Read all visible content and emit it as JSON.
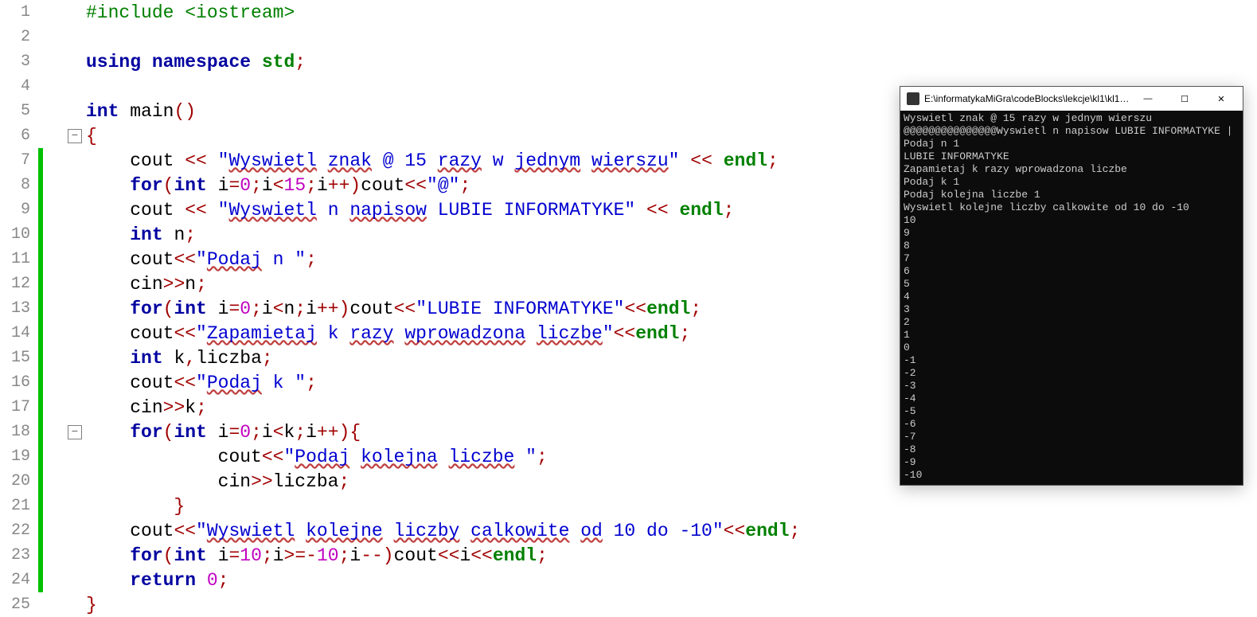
{
  "editor": {
    "lines": [
      {
        "n": "1",
        "margin": false,
        "fold": null,
        "tokens": [
          [
            "preproc",
            "#include <iostream>"
          ]
        ]
      },
      {
        "n": "2",
        "margin": false,
        "fold": null,
        "tokens": []
      },
      {
        "n": "3",
        "margin": false,
        "fold": null,
        "tokens": [
          [
            "kw",
            "using"
          ],
          [
            "ident",
            " "
          ],
          [
            "kw",
            "namespace"
          ],
          [
            "ident",
            " "
          ],
          [
            "std",
            "std"
          ],
          [
            "op",
            ";"
          ]
        ]
      },
      {
        "n": "4",
        "margin": false,
        "fold": null,
        "tokens": []
      },
      {
        "n": "5",
        "margin": false,
        "fold": null,
        "tokens": [
          [
            "kw",
            "int"
          ],
          [
            "ident",
            " "
          ],
          [
            "func",
            "main"
          ],
          [
            "op",
            "()"
          ]
        ]
      },
      {
        "n": "6",
        "margin": false,
        "fold": "box",
        "tokens": [
          [
            "op",
            "{"
          ]
        ]
      },
      {
        "n": "7",
        "margin": true,
        "fold": "line",
        "tokens": [
          [
            "ident",
            "    "
          ],
          [
            "ident",
            "cout"
          ],
          [
            "ident",
            " "
          ],
          [
            "op",
            "<<"
          ],
          [
            "ident",
            " "
          ],
          [
            "str",
            "\""
          ],
          [
            "str-u",
            "Wyswietl"
          ],
          [
            "str",
            " "
          ],
          [
            "str-u",
            "znak"
          ],
          [
            "str",
            " @ 15 "
          ],
          [
            "str-u",
            "razy"
          ],
          [
            "str",
            " w "
          ],
          [
            "str-u",
            "jednym"
          ],
          [
            "str",
            " "
          ],
          [
            "str-u",
            "wierszu"
          ],
          [
            "str",
            "\""
          ],
          [
            "ident",
            " "
          ],
          [
            "op",
            "<<"
          ],
          [
            "ident",
            " "
          ],
          [
            "endl",
            "endl"
          ],
          [
            "op",
            ";"
          ]
        ]
      },
      {
        "n": "8",
        "margin": true,
        "fold": "line",
        "tokens": [
          [
            "ident",
            "    "
          ],
          [
            "kw",
            "for"
          ],
          [
            "op",
            "("
          ],
          [
            "kw",
            "int"
          ],
          [
            "ident",
            " i"
          ],
          [
            "op",
            "="
          ],
          [
            "num",
            "0"
          ],
          [
            "op",
            ";"
          ],
          [
            "ident",
            "i"
          ],
          [
            "op",
            "<"
          ],
          [
            "num",
            "15"
          ],
          [
            "op",
            ";"
          ],
          [
            "ident",
            "i"
          ],
          [
            "op",
            "++)"
          ],
          [
            "ident",
            "cout"
          ],
          [
            "op",
            "<<"
          ],
          [
            "str",
            "\"@\""
          ],
          [
            "op",
            ";"
          ]
        ]
      },
      {
        "n": "9",
        "margin": true,
        "fold": "line",
        "tokens": [
          [
            "ident",
            "    "
          ],
          [
            "ident",
            "cout"
          ],
          [
            "ident",
            " "
          ],
          [
            "op",
            "<<"
          ],
          [
            "ident",
            " "
          ],
          [
            "str",
            "\""
          ],
          [
            "str-u",
            "Wyswietl"
          ],
          [
            "str",
            " n "
          ],
          [
            "str-u",
            "napisow"
          ],
          [
            "str",
            " LUBIE INFORMATYKE\""
          ],
          [
            "ident",
            " "
          ],
          [
            "op",
            "<<"
          ],
          [
            "ident",
            " "
          ],
          [
            "endl",
            "endl"
          ],
          [
            "op",
            ";"
          ]
        ]
      },
      {
        "n": "10",
        "margin": true,
        "fold": "line",
        "tokens": [
          [
            "ident",
            "    "
          ],
          [
            "kw",
            "int"
          ],
          [
            "ident",
            " n"
          ],
          [
            "op",
            ";"
          ]
        ]
      },
      {
        "n": "11",
        "margin": true,
        "fold": "line",
        "tokens": [
          [
            "ident",
            "    "
          ],
          [
            "ident",
            "cout"
          ],
          [
            "op",
            "<<"
          ],
          [
            "str",
            "\""
          ],
          [
            "str-u",
            "Podaj"
          ],
          [
            "str",
            " n \""
          ],
          [
            "op",
            ";"
          ]
        ]
      },
      {
        "n": "12",
        "margin": true,
        "fold": "line",
        "tokens": [
          [
            "ident",
            "    "
          ],
          [
            "ident",
            "cin"
          ],
          [
            "op",
            ">>"
          ],
          [
            "ident",
            "n"
          ],
          [
            "op",
            ";"
          ]
        ]
      },
      {
        "n": "13",
        "margin": true,
        "fold": "line",
        "tokens": [
          [
            "ident",
            "    "
          ],
          [
            "kw",
            "for"
          ],
          [
            "op",
            "("
          ],
          [
            "kw",
            "int"
          ],
          [
            "ident",
            " i"
          ],
          [
            "op",
            "="
          ],
          [
            "num",
            "0"
          ],
          [
            "op",
            ";"
          ],
          [
            "ident",
            "i"
          ],
          [
            "op",
            "<"
          ],
          [
            "ident",
            "n"
          ],
          [
            "op",
            ";"
          ],
          [
            "ident",
            "i"
          ],
          [
            "op",
            "++)"
          ],
          [
            "ident",
            "cout"
          ],
          [
            "op",
            "<<"
          ],
          [
            "str",
            "\"LUBIE INFORMATYKE\""
          ],
          [
            "op",
            "<<"
          ],
          [
            "endl",
            "endl"
          ],
          [
            "op",
            ";"
          ]
        ]
      },
      {
        "n": "14",
        "margin": true,
        "fold": "line",
        "tokens": [
          [
            "ident",
            "    "
          ],
          [
            "ident",
            "cout"
          ],
          [
            "op",
            "<<"
          ],
          [
            "str",
            "\""
          ],
          [
            "str-u",
            "Zapamietaj"
          ],
          [
            "str",
            " k "
          ],
          [
            "str-u",
            "razy"
          ],
          [
            "str",
            " "
          ],
          [
            "str-u",
            "wprowadzona"
          ],
          [
            "str",
            " "
          ],
          [
            "str-u",
            "liczbe"
          ],
          [
            "str",
            "\""
          ],
          [
            "op",
            "<<"
          ],
          [
            "endl",
            "endl"
          ],
          [
            "op",
            ";"
          ]
        ]
      },
      {
        "n": "15",
        "margin": true,
        "fold": "line",
        "tokens": [
          [
            "ident",
            "    "
          ],
          [
            "kw",
            "int"
          ],
          [
            "ident",
            " k"
          ],
          [
            "op",
            ","
          ],
          [
            "ident",
            "liczba"
          ],
          [
            "op",
            ";"
          ]
        ]
      },
      {
        "n": "16",
        "margin": true,
        "fold": "line",
        "tokens": [
          [
            "ident",
            "    "
          ],
          [
            "ident",
            "cout"
          ],
          [
            "op",
            "<<"
          ],
          [
            "str",
            "\""
          ],
          [
            "str-u",
            "Podaj"
          ],
          [
            "str",
            " k \""
          ],
          [
            "op",
            ";"
          ]
        ]
      },
      {
        "n": "17",
        "margin": true,
        "fold": "line",
        "tokens": [
          [
            "ident",
            "    "
          ],
          [
            "ident",
            "cin"
          ],
          [
            "op",
            ">>"
          ],
          [
            "ident",
            "k"
          ],
          [
            "op",
            ";"
          ]
        ]
      },
      {
        "n": "18",
        "margin": true,
        "fold": "box",
        "tokens": [
          [
            "ident",
            "    "
          ],
          [
            "kw",
            "for"
          ],
          [
            "op",
            "("
          ],
          [
            "kw",
            "int"
          ],
          [
            "ident",
            " i"
          ],
          [
            "op",
            "="
          ],
          [
            "num",
            "0"
          ],
          [
            "op",
            ";"
          ],
          [
            "ident",
            "i"
          ],
          [
            "op",
            "<"
          ],
          [
            "ident",
            "k"
          ],
          [
            "op",
            ";"
          ],
          [
            "ident",
            "i"
          ],
          [
            "op",
            "++){"
          ]
        ]
      },
      {
        "n": "19",
        "margin": true,
        "fold": "line",
        "tokens": [
          [
            "ident",
            "            "
          ],
          [
            "ident",
            "cout"
          ],
          [
            "op",
            "<<"
          ],
          [
            "str",
            "\""
          ],
          [
            "str-u",
            "Podaj"
          ],
          [
            "str",
            " "
          ],
          [
            "str-u",
            "kolejna"
          ],
          [
            "str",
            " "
          ],
          [
            "str-u",
            "liczbe"
          ],
          [
            "str",
            " \""
          ],
          [
            "op",
            ";"
          ]
        ]
      },
      {
        "n": "20",
        "margin": true,
        "fold": "line",
        "tokens": [
          [
            "ident",
            "            "
          ],
          [
            "ident",
            "cin"
          ],
          [
            "op",
            ">>"
          ],
          [
            "ident",
            "liczba"
          ],
          [
            "op",
            ";"
          ]
        ]
      },
      {
        "n": "21",
        "margin": true,
        "fold": "end",
        "tokens": [
          [
            "ident",
            "        "
          ],
          [
            "op",
            "}"
          ]
        ]
      },
      {
        "n": "22",
        "margin": true,
        "fold": "line",
        "tokens": [
          [
            "ident",
            "    "
          ],
          [
            "ident",
            "cout"
          ],
          [
            "op",
            "<<"
          ],
          [
            "str",
            "\""
          ],
          [
            "str-u",
            "Wyswietl"
          ],
          [
            "str",
            " "
          ],
          [
            "str-u",
            "kolejne"
          ],
          [
            "str",
            " "
          ],
          [
            "str-u",
            "liczby"
          ],
          [
            "str",
            " "
          ],
          [
            "str-u",
            "calkowite"
          ],
          [
            "str",
            " "
          ],
          [
            "str-u",
            "od"
          ],
          [
            "str",
            " 10 do -10\""
          ],
          [
            "op",
            "<<"
          ],
          [
            "endl",
            "endl"
          ],
          [
            "op",
            ";"
          ]
        ]
      },
      {
        "n": "23",
        "margin": true,
        "fold": "line",
        "tokens": [
          [
            "ident",
            "    "
          ],
          [
            "kw",
            "for"
          ],
          [
            "op",
            "("
          ],
          [
            "kw",
            "int"
          ],
          [
            "ident",
            " i"
          ],
          [
            "op",
            "="
          ],
          [
            "num",
            "10"
          ],
          [
            "op",
            ";"
          ],
          [
            "ident",
            "i"
          ],
          [
            "op",
            ">=-"
          ],
          [
            "num",
            "10"
          ],
          [
            "op",
            ";"
          ],
          [
            "ident",
            "i"
          ],
          [
            "op",
            "--)"
          ],
          [
            "ident",
            "cout"
          ],
          [
            "op",
            "<<"
          ],
          [
            "ident",
            "i"
          ],
          [
            "op",
            "<<"
          ],
          [
            "endl",
            "endl"
          ],
          [
            "op",
            ";"
          ]
        ]
      },
      {
        "n": "24",
        "margin": true,
        "fold": "line",
        "tokens": [
          [
            "ident",
            "    "
          ],
          [
            "kw",
            "return"
          ],
          [
            "ident",
            " "
          ],
          [
            "num",
            "0"
          ],
          [
            "op",
            ";"
          ]
        ]
      },
      {
        "n": "25",
        "margin": false,
        "fold": "line",
        "tokens": [
          [
            "op",
            "}"
          ]
        ]
      }
    ]
  },
  "console": {
    "title": "E:\\informatykaMiGra\\codeBlocks\\lekcje\\kl1\\kl1-...",
    "buttons": {
      "minimize": "—",
      "maximize": "☐",
      "close": "✕"
    },
    "output": "Wyswietl znak @ 15 razy w jednym wierszu\n@@@@@@@@@@@@@@@Wyswietl n napisow LUBIE INFORMATYKE |\nPodaj n 1\nLUBIE INFORMATYKE\nZapamietaj k razy wprowadzona liczbe\nPodaj k 1\nPodaj kolejna liczbe 1\nWyswietl kolejne liczby calkowite od 10 do -10\n10\n9\n8\n7\n6\n5\n4\n3\n2\n1\n0\n-1\n-2\n-3\n-4\n-5\n-6\n-7\n-8\n-9\n-10"
  }
}
